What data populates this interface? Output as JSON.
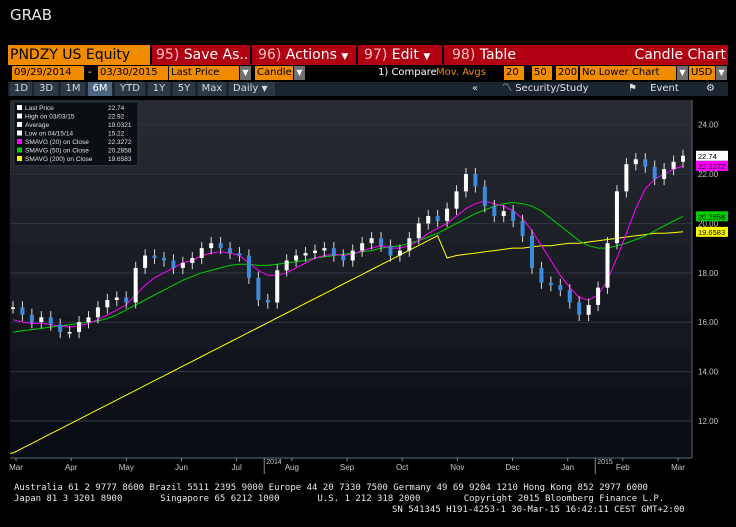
{
  "window": {
    "title": "GRAB"
  },
  "toolbar": {
    "ticker": "PNDZY US Equity",
    "buttons": [
      {
        "num": "95)",
        "label": "Save As..."
      },
      {
        "num": "96)",
        "label": "Actions"
      },
      {
        "num": "97)",
        "label": "Edit"
      },
      {
        "num": "98)",
        "label": "Table"
      }
    ],
    "chart_title": "Candle Chart"
  },
  "controls": {
    "start_date": "09/29/2014",
    "dash": "-",
    "end_date": "03/30/2015",
    "price_field": "Last Price",
    "chart_style": "Candle",
    "compare_label": "1) Compare",
    "compare_value": "Mov. Avgs",
    "ma1": "20",
    "ma2": "50",
    "ma3": "200",
    "lower_chart": "No Lower Chart",
    "currency": "USD"
  },
  "periods": {
    "buttons": [
      "1D",
      "3D",
      "1M",
      "6M",
      "YTD",
      "1Y",
      "5Y",
      "Max"
    ],
    "active": "6M",
    "frequency": "Daily",
    "nav_back": "«",
    "security_study": "Security/Study",
    "event": "Event"
  },
  "legend": [
    {
      "label": "Last Price",
      "value": "22.74",
      "color": "#ffffff"
    },
    {
      "label": "High on 03/03/15",
      "value": "22.92",
      "color": "#ffffff"
    },
    {
      "label": "Average",
      "value": "19.0321",
      "color": "#ffffff"
    },
    {
      "label": "Low on 04/15/14",
      "value": "15.22",
      "color": "#ffffff"
    },
    {
      "label": "SMAVG (20) on Close",
      "value": "22.3272",
      "color": "#ff00ff"
    },
    {
      "label": "SMAVG (50) on Close",
      "value": "20.2858",
      "color": "#00d000"
    },
    {
      "label": "SMAVG (200) on Close",
      "value": "19.6583",
      "color": "#ffff00"
    }
  ],
  "chart_data": {
    "type": "line",
    "ylim": [
      10.5,
      25.0
    ],
    "yticks": [
      "12.00",
      "14.00",
      "16.00",
      "18.00",
      "20.00",
      "22.00",
      "24.00"
    ],
    "ytick_values": [
      12,
      14,
      16,
      18,
      20,
      22,
      24
    ],
    "xticks": [
      "Mar",
      "Apr",
      "May",
      "Jun",
      "Jul",
      "Aug",
      "Sep",
      "Oct",
      "Nov",
      "Dec",
      "Jan",
      "Feb",
      "Mar"
    ],
    "year_labels": [
      {
        "label": "2014",
        "after_index": 4
      },
      {
        "label": "2015",
        "after_index": 10
      }
    ],
    "x_count": 13,
    "price": [
      16.6,
      16.3,
      16.0,
      16.2,
      15.9,
      15.6,
      15.6,
      16.0,
      16.2,
      16.6,
      16.9,
      17.0,
      16.8,
      18.2,
      18.7,
      18.6,
      18.5,
      18.2,
      18.4,
      18.6,
      19.0,
      19.2,
      19.0,
      18.8,
      18.7,
      17.8,
      16.9,
      16.8,
      18.1,
      18.5,
      18.7,
      18.8,
      18.9,
      19.0,
      18.7,
      18.5,
      18.9,
      19.2,
      19.4,
      19.1,
      18.7,
      18.9,
      19.4,
      20.0,
      20.3,
      20.1,
      20.6,
      21.3,
      22.0,
      21.5,
      20.7,
      20.3,
      20.5,
      20.1,
      19.5,
      18.2,
      17.6,
      17.5,
      17.3,
      16.8,
      16.3,
      16.7,
      17.4,
      19.2,
      21.3,
      22.4,
      22.6,
      22.3,
      21.8,
      22.2,
      22.5,
      22.74
    ],
    "sma20": [
      16.1,
      16.0,
      15.95,
      15.95,
      15.9,
      15.85,
      15.8,
      15.85,
      15.95,
      16.1,
      16.3,
      16.5,
      16.7,
      17.1,
      17.5,
      17.8,
      18.0,
      18.2,
      18.4,
      18.5,
      18.7,
      18.8,
      18.85,
      18.8,
      18.7,
      18.4,
      18.1,
      17.9,
      17.9,
      18.0,
      18.2,
      18.4,
      18.6,
      18.7,
      18.75,
      18.7,
      18.75,
      18.9,
      19.0,
      19.1,
      19.0,
      19.0,
      19.1,
      19.3,
      19.6,
      19.8,
      20.0,
      20.3,
      20.6,
      20.8,
      20.9,
      20.8,
      20.7,
      20.5,
      20.2,
      19.7,
      19.1,
      18.5,
      17.9,
      17.4,
      17.0,
      16.9,
      17.1,
      17.7,
      18.6,
      19.6,
      20.6,
      21.4,
      21.8,
      22.0,
      22.2,
      22.33
    ],
    "sma50": [
      15.6,
      15.65,
      15.7,
      15.75,
      15.8,
      15.85,
      15.9,
      15.95,
      16.0,
      16.05,
      16.15,
      16.3,
      16.5,
      16.7,
      16.9,
      17.1,
      17.3,
      17.5,
      17.7,
      17.85,
      18.0,
      18.1,
      18.2,
      18.3,
      18.35,
      18.35,
      18.3,
      18.3,
      18.35,
      18.4,
      18.45,
      18.5,
      18.6,
      18.65,
      18.7,
      18.75,
      18.8,
      18.85,
      18.9,
      19.0,
      19.05,
      19.1,
      19.2,
      19.3,
      19.45,
      19.6,
      19.8,
      20.0,
      20.2,
      20.4,
      20.55,
      20.7,
      20.8,
      20.85,
      20.8,
      20.7,
      20.5,
      20.2,
      19.9,
      19.6,
      19.3,
      19.1,
      19.0,
      19.0,
      19.1,
      19.2,
      19.35,
      19.5,
      19.7,
      19.9,
      20.1,
      20.29
    ],
    "sma200": [
      15.05,
      15.1,
      15.15,
      15.2,
      15.25,
      15.3,
      15.35,
      15.4,
      15.45,
      15.5,
      15.55,
      15.6,
      15.65,
      15.7,
      15.75,
      15.8,
      15.85,
      15.9,
      15.95,
      16.0,
      16.05,
      16.1,
      16.2,
      16.3,
      16.4,
      16.5,
      16.6,
      16.7,
      16.8,
      16.9,
      17.0,
      17.1,
      17.2,
      17.3,
      17.4,
      17.5,
      17.6,
      17.7,
      17.8,
      17.9,
      18.0,
      18.1,
      18.2,
      18.3,
      18.4,
      18.5,
      18.6,
      18.7,
      18.75,
      18.8,
      18.85,
      18.9,
      18.95,
      19.0,
      19.0,
      19.05,
      19.1,
      19.1,
      19.15,
      19.2,
      19.2,
      19.25,
      19.3,
      19.35,
      19.4,
      19.45,
      19.5,
      19.55,
      19.6,
      19.6,
      19.63,
      19.66
    ],
    "sma200_start": 10.7,
    "series": [
      {
        "name": "Last Price",
        "color": "#ffffff"
      },
      {
        "name": "SMAVG (20) on Close",
        "color": "#ff00ff"
      },
      {
        "name": "SMAVG (50) on Close",
        "color": "#00d000"
      },
      {
        "name": "SMAVG (200) on Close",
        "color": "#ffff00"
      }
    ],
    "last_tags": [
      {
        "text": "22.74",
        "value": 22.74,
        "bg": "#ffffff",
        "fg": "#000000"
      },
      {
        "text": "22.3272",
        "value": 22.33,
        "bg": "#ff00ff",
        "fg": "#000000"
      },
      {
        "text": "20.2858",
        "value": 20.29,
        "bg": "#00d000",
        "fg": "#000000"
      },
      {
        "text": "19.6583",
        "value": 19.66,
        "bg": "#ffff00",
        "fg": "#000000"
      }
    ]
  },
  "footer": {
    "line1": "Australia 61 2 9777 8600 Brazil 5511 2395 9000 Europe 44 20 7330 7500 Germany 49 69 9204 1210 Hong Kong 852 2977 6000",
    "line2": "Japan 81 3 3201 8900       Singapore 65 6212 1000       U.S. 1 212 318 2000        Copyright 2015 Bloomberg Finance L.P.",
    "line3": "SN 541345 H191-4253-1 30-Mar-15 16:42:11 CEST GMT+2:00"
  }
}
